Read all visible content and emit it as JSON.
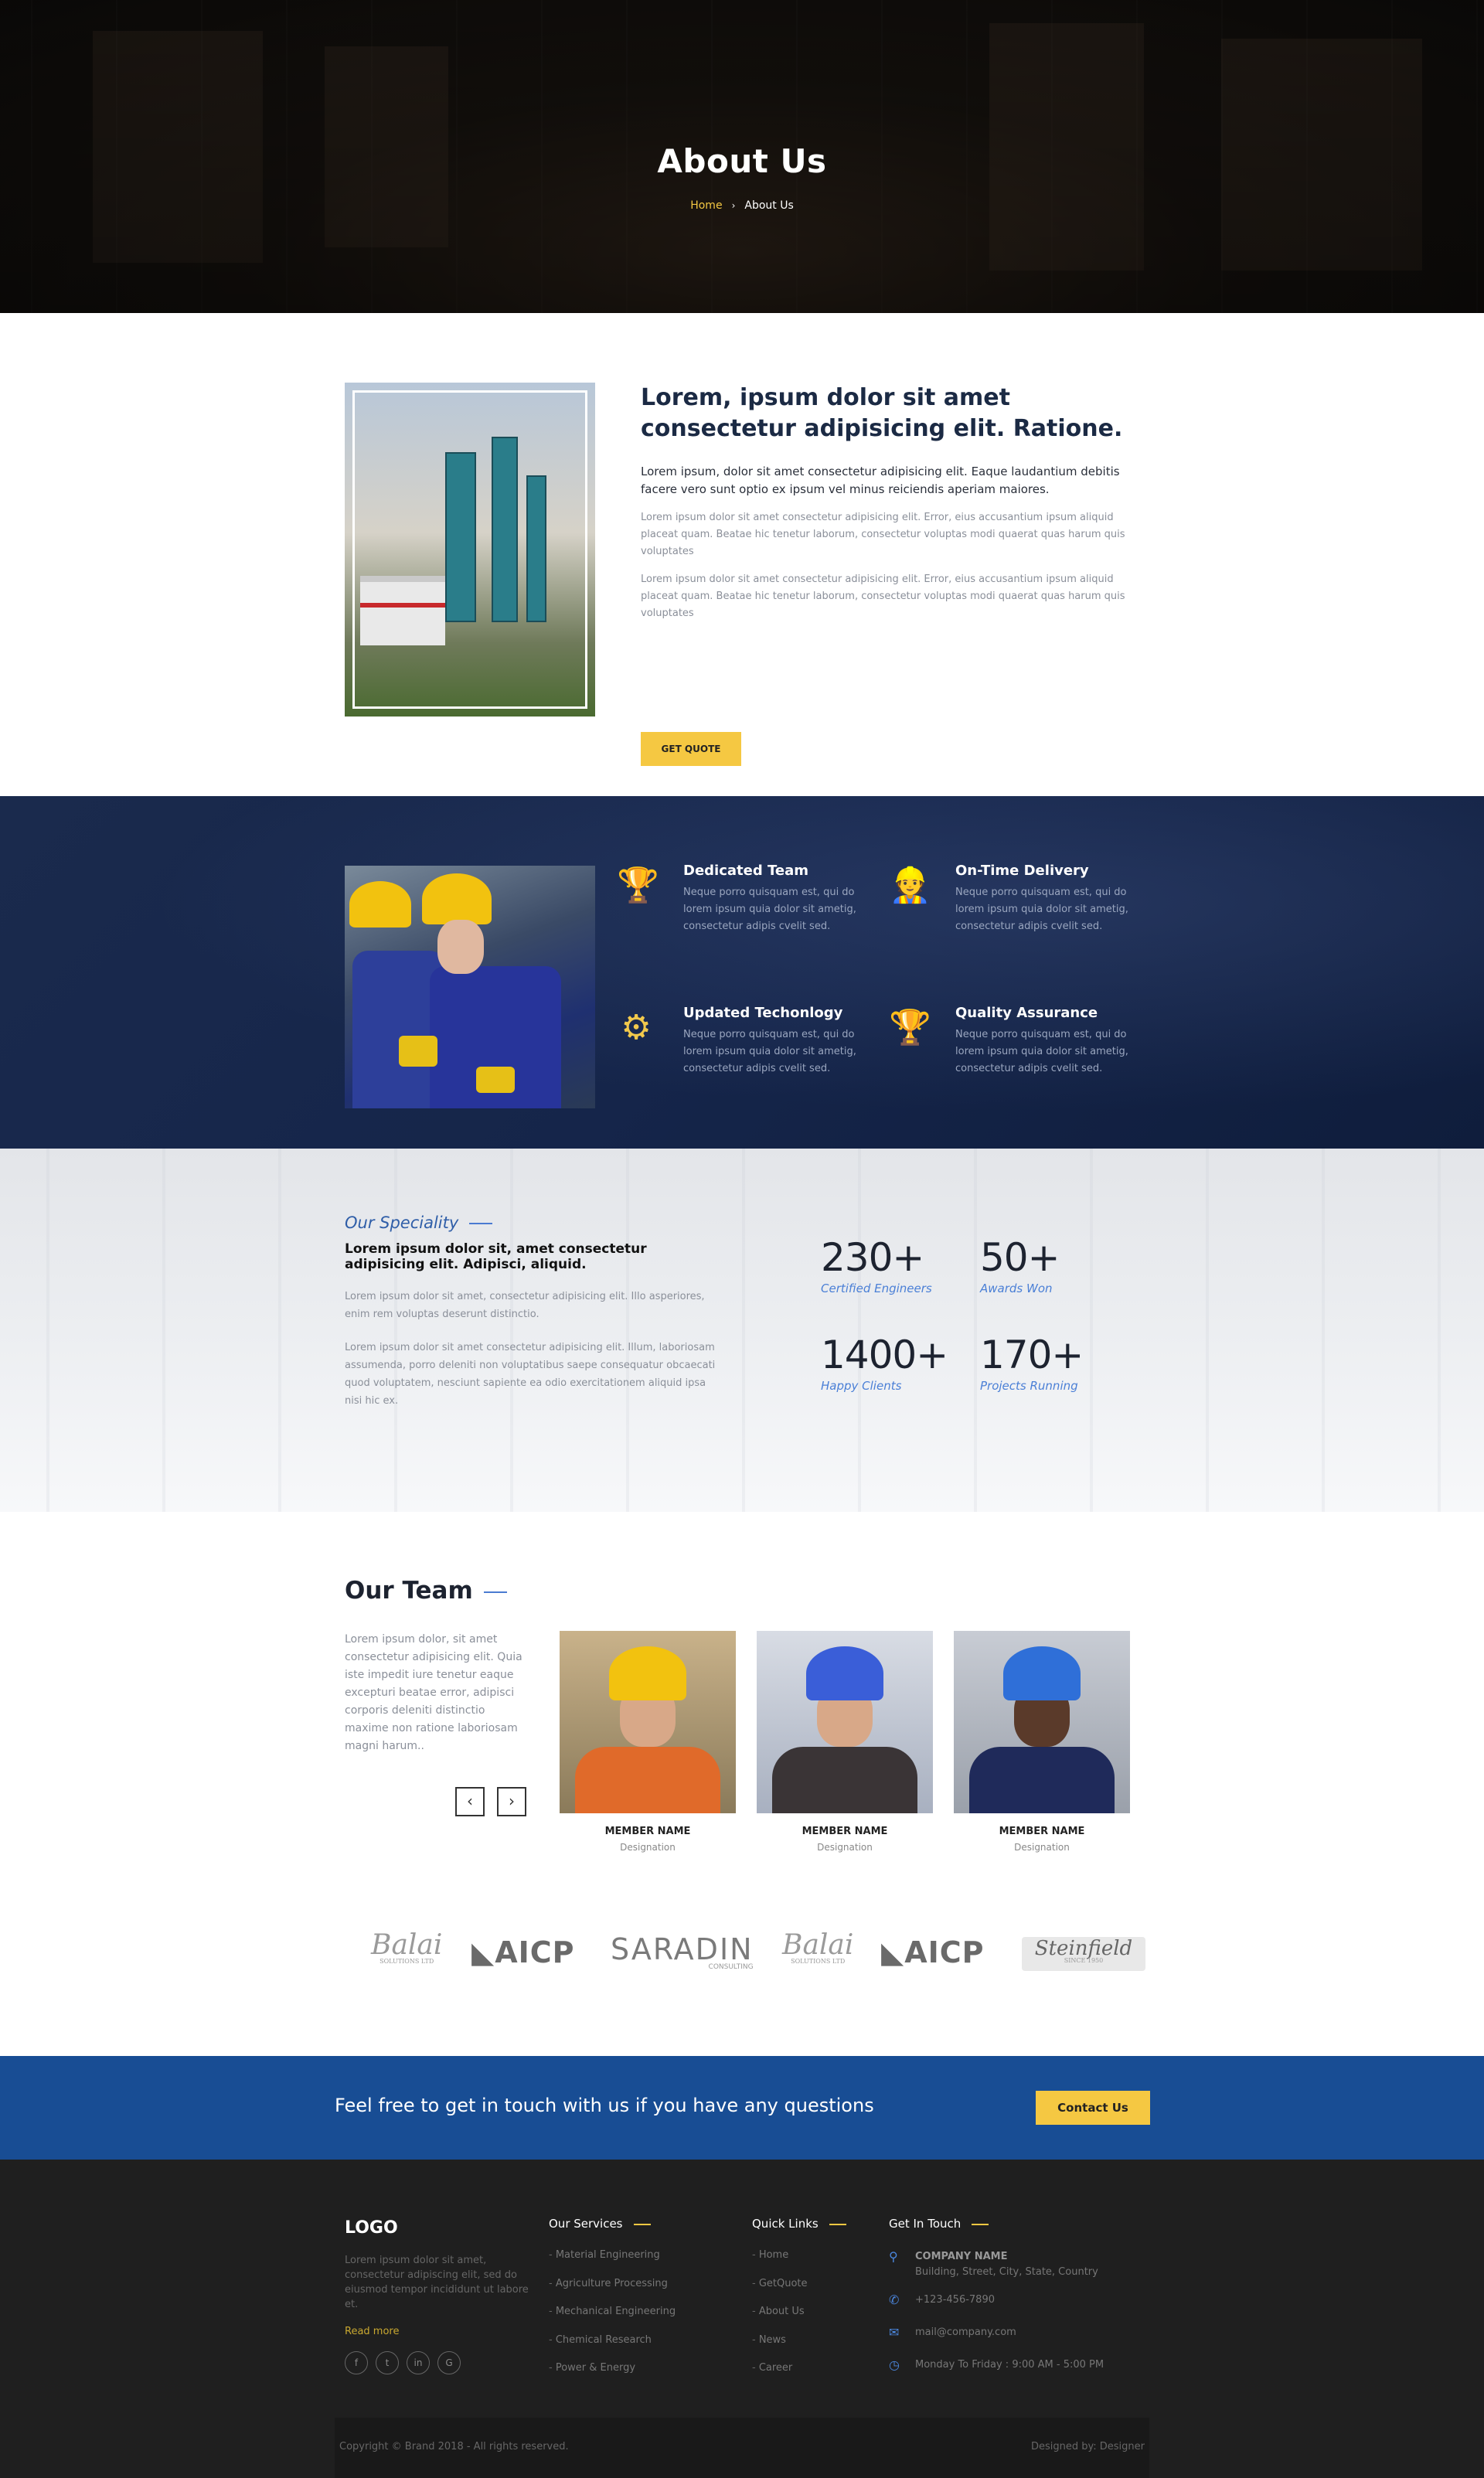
{
  "hero": {
    "title": "About Us",
    "breadcrumb_home": "Home",
    "breadcrumb_separator": "›",
    "breadcrumb_current": "About Us"
  },
  "about": {
    "heading": "Lorem, ipsum dolor sit amet consectetur adipisicing elit. Ratione.",
    "lead": "Lorem ipsum, dolor sit amet consectetur adipisicing elit. Eaque laudantium debitis facere vero sunt optio ex ipsum vel minus reiciendis aperiam maiores.",
    "paragraphs": [
      "Lorem ipsum dolor sit amet consectetur adipisicing elit. Error, eius accusantium ipsum aliquid placeat quam. Beatae hic tenetur laborum, consectetur voluptas modi quaerat quas harum quis voluptates",
      "Lorem ipsum dolor sit amet consectetur adipisicing elit. Error, eius accusantium ipsum aliquid placeat quam. Beatae hic tenetur laborum, consectetur voluptas modi quaerat quas harum quis voluptates"
    ],
    "button": "GET QUOTE"
  },
  "features": [
    {
      "icon": "trophy-icon",
      "title": "Dedicated Team",
      "text": "Neque porro quisquam est, qui do lorem ipsum quia dolor sit ametig, consectetur adipis cvelit sed."
    },
    {
      "icon": "worker-icon",
      "title": "On-Time Delivery",
      "text": "Neque porro quisquam est, qui do lorem ipsum quia dolor sit ametig, consectetur adipis cvelit sed."
    },
    {
      "icon": "gear-wrench-icon",
      "title": "Updated Techonlogy",
      "text": "Neque porro quisquam est, qui do lorem ipsum quia dolor sit ametig, consectetur adipis cvelit sed."
    },
    {
      "icon": "trophy-icon",
      "title": "Quality Assurance",
      "text": "Neque porro quisquam est, qui do lorem ipsum quia dolor sit ametig, consectetur adipis cvelit sed."
    }
  ],
  "speciality": {
    "tag": "Our Speciality",
    "heading": "Lorem ipsum dolor sit, amet consectetur adipisicing elit. Adipisci, aliquid.",
    "p1": "Lorem ipsum dolor sit amet, consectetur adipisicing elit. Illo asperiores, enim rem voluptas deserunt distinctio.",
    "p2": "Lorem ipsum dolor sit amet consectetur adipisicing elit. Illum, laboriosam assumenda, porro deleniti non voluptatibus saepe consequatur obcaecati quod voluptatem, nesciunt sapiente ea odio exercitationem aliquid ipsa nisi hic ex.",
    "stats": [
      {
        "num": "230+",
        "label": "Certified Engineers"
      },
      {
        "num": "50+",
        "label": "Awards Won"
      },
      {
        "num": "1400+",
        "label": "Happy Clients"
      },
      {
        "num": "170+",
        "label": "Projects Running"
      }
    ]
  },
  "team": {
    "title": "Our Team",
    "desc": "Lorem ipsum dolor, sit amet consectetur adipisicing elit. Quia iste impedit iure tenetur eaque excepturi beatae error, adipisci corporis deleniti distinctio maxime non ratione laboriosam magni harum..",
    "prev": "‹",
    "next": "›",
    "members": [
      {
        "name": "MEMBER NAME",
        "designation": "Designation"
      },
      {
        "name": "MEMBER NAME",
        "designation": "Designation"
      },
      {
        "name": "MEMBER NAME",
        "designation": "Designation"
      }
    ],
    "logos": [
      "Balai",
      "AICP",
      "SARADIN",
      "Balai",
      "AICP",
      "Steinfield"
    ],
    "logo_sub": {
      "balai": "SOLUTIONS LTD",
      "saradin": "CONSULTING",
      "steinfield": "SINCE 1950"
    }
  },
  "cta": {
    "message": "Feel free to get in touch with us if you have any questions",
    "button": "Contact Us"
  },
  "footer": {
    "logo": "LOGO",
    "desc": "Lorem ipsum dolor sit amet, consectetur adipiscing elit, sed do eiusmod tempor incididunt ut labore et.",
    "read_more": "Read more",
    "social": [
      "f",
      "t",
      "in",
      "G"
    ],
    "services_title": "Our Services",
    "services": [
      "Material Engineering",
      "Agriculture Processing",
      "Mechanical Engineering",
      "Chemical Research",
      "Power & Energy"
    ],
    "links_title": "Quick Links",
    "links": [
      "Home",
      "GetQuote",
      "About Us",
      "News",
      "Career"
    ],
    "contact_title": "Get In Touch",
    "company": "COMPANY NAME",
    "address": "Building, Street, City, State, Country",
    "phone": "+123-456-7890",
    "email": "mail@company.com",
    "hours": "Monday To Friday : 9:00 AM - 5:00 PM",
    "copyright": "Copyright © Brand 2018 - All rights reserved.",
    "designed_by": "Designed by: Designer"
  },
  "colors": {
    "accent_yellow": "#f5c842",
    "navy": "#15254a",
    "cta_blue": "#184d94",
    "link_blue": "#4a7fd6"
  }
}
